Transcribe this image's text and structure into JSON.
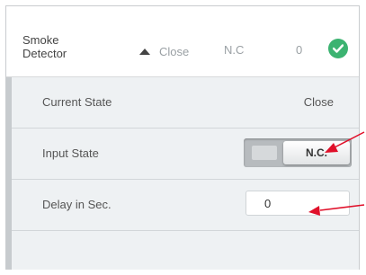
{
  "header": {
    "device_name": "Smoke Detector",
    "state": "Close",
    "mode": "N.C",
    "delay": "0",
    "status_color": "#3cb371"
  },
  "details": {
    "current_state": {
      "label": "Current State",
      "value": "Close"
    },
    "input_state": {
      "label": "Input State",
      "value": "N.C."
    },
    "delay": {
      "label": "Delay in Sec.",
      "value": "0"
    }
  },
  "annotation_color": "#e0102a",
  "icons": [
    "state-arrow-up-icon",
    "check-circle-icon",
    "annotation-arrow-icon"
  ]
}
